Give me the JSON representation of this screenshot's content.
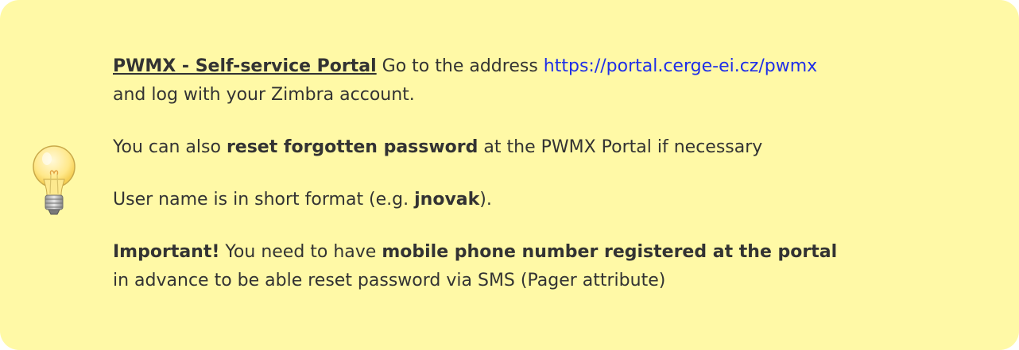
{
  "note": {
    "icon": "lightbulb-icon",
    "background_color": "#fff9a6",
    "link_color": "#1f2fe8",
    "paragraph_1": {
      "title": "PWMX - Self-service Portal",
      "text_before_link": " Go to the address ",
      "link_text": "https://portal.cerge-ei.cz/pwmx",
      "text_after_link": "and log with your Zimbra account."
    },
    "paragraph_2": {
      "text_before": "You can also ",
      "bold": "reset forgotten password",
      "text_after": " at the PWMX Portal if necessary"
    },
    "paragraph_3": {
      "text_before": "User name is in short format (e.g. ",
      "bold": "jnovak",
      "text_after": ")."
    },
    "paragraph_4": {
      "important": "Important!",
      "text_middle": " You need to have ",
      "bold": "mobile phone number registered at the portal",
      "text_after": "in advance to be able reset password via SMS (Pager attribute)"
    }
  }
}
